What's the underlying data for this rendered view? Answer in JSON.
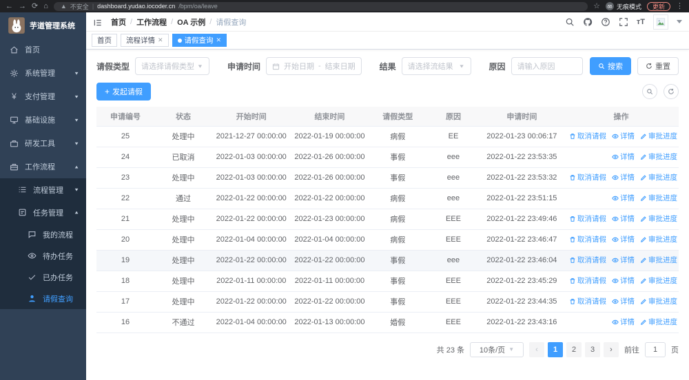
{
  "browser": {
    "security_label": "不安全",
    "url_host": "dashboard.yudao.iocoder.cn",
    "url_path": "/bpm/oa/leave",
    "incognito_label": "无痕模式",
    "update_label": "更新"
  },
  "sidebar": {
    "title": "芋道管理系统",
    "items": [
      {
        "label": "首页"
      },
      {
        "label": "系统管理"
      },
      {
        "label": "支付管理"
      },
      {
        "label": "基础设施"
      },
      {
        "label": "研发工具"
      },
      {
        "label": "工作流程"
      }
    ],
    "submenu": [
      {
        "label": "流程管理"
      },
      {
        "label": "任务管理"
      }
    ],
    "leaves": [
      {
        "label": "我的流程"
      },
      {
        "label": "待办任务"
      },
      {
        "label": "已办任务"
      },
      {
        "label": "请假查询"
      }
    ]
  },
  "navbar": {
    "breadcrumb": [
      "首页",
      "工作流程",
      "OA 示例",
      "请假查询"
    ]
  },
  "tags": [
    {
      "label": "首页"
    },
    {
      "label": "流程详情"
    },
    {
      "label": "请假查询"
    }
  ],
  "filters": {
    "leave_type_label": "请假类型",
    "leave_type_placeholder": "请选择请假类型",
    "apply_time_label": "申请时间",
    "date_start_placeholder": "开始日期",
    "date_separator": "-",
    "date_end_placeholder": "结束日期",
    "result_label": "结果",
    "result_placeholder": "请选择流结果",
    "reason_label": "原因",
    "reason_placeholder": "请输入原因",
    "search_label": "搜索",
    "reset_label": "重置"
  },
  "toolbar": {
    "create_label": "发起请假"
  },
  "table": {
    "headers": [
      "申请编号",
      "状态",
      "开始时间",
      "结束时间",
      "请假类型",
      "原因",
      "申请时间",
      "操作"
    ],
    "action_labels": {
      "cancel": "取消请假",
      "detail": "详情",
      "progress": "审批进度"
    },
    "rows": [
      {
        "id": "25",
        "status": "处理中",
        "start": "2021-12-27 00:00:00",
        "end": "2022-01-19 00:00:00",
        "type": "病假",
        "reason": "EE",
        "applied": "2022-01-23 00:06:17",
        "cancelable": true,
        "highlight": false
      },
      {
        "id": "24",
        "status": "已取消",
        "start": "2022-01-03 00:00:00",
        "end": "2022-01-26 00:00:00",
        "type": "事假",
        "reason": "eee",
        "applied": "2022-01-22 23:53:35",
        "cancelable": false,
        "highlight": false
      },
      {
        "id": "23",
        "status": "处理中",
        "start": "2022-01-03 00:00:00",
        "end": "2022-01-26 00:00:00",
        "type": "事假",
        "reason": "eee",
        "applied": "2022-01-22 23:53:32",
        "cancelable": true,
        "highlight": false
      },
      {
        "id": "22",
        "status": "通过",
        "start": "2022-01-22 00:00:00",
        "end": "2022-01-22 00:00:00",
        "type": "病假",
        "reason": "eee",
        "applied": "2022-01-22 23:51:15",
        "cancelable": false,
        "highlight": false
      },
      {
        "id": "21",
        "status": "处理中",
        "start": "2022-01-22 00:00:00",
        "end": "2022-01-23 00:00:00",
        "type": "病假",
        "reason": "EEE",
        "applied": "2022-01-22 23:49:46",
        "cancelable": true,
        "highlight": false
      },
      {
        "id": "20",
        "status": "处理中",
        "start": "2022-01-04 00:00:00",
        "end": "2022-01-04 00:00:00",
        "type": "病假",
        "reason": "EEE",
        "applied": "2022-01-22 23:46:47",
        "cancelable": true,
        "highlight": false
      },
      {
        "id": "19",
        "status": "处理中",
        "start": "2022-01-22 00:00:00",
        "end": "2022-01-22 00:00:00",
        "type": "事假",
        "reason": "eee",
        "applied": "2022-01-22 23:46:04",
        "cancelable": true,
        "highlight": true
      },
      {
        "id": "18",
        "status": "处理中",
        "start": "2022-01-11 00:00:00",
        "end": "2022-01-11 00:00:00",
        "type": "事假",
        "reason": "EEE",
        "applied": "2022-01-22 23:45:29",
        "cancelable": true,
        "highlight": false
      },
      {
        "id": "17",
        "status": "处理中",
        "start": "2022-01-22 00:00:00",
        "end": "2022-01-22 00:00:00",
        "type": "事假",
        "reason": "EEE",
        "applied": "2022-01-22 23:44:35",
        "cancelable": true,
        "highlight": false
      },
      {
        "id": "16",
        "status": "不通过",
        "start": "2022-01-04 00:00:00",
        "end": "2022-01-13 00:00:00",
        "type": "婚假",
        "reason": "EEE",
        "applied": "2022-01-22 23:43:16",
        "cancelable": false,
        "highlight": false
      }
    ]
  },
  "pagination": {
    "total": "共 23 条",
    "page_size": "10条/页",
    "pages": [
      "1",
      "2",
      "3"
    ],
    "active_page": "1",
    "goto_label": "前往",
    "goto_value": "1",
    "page_label": "页"
  }
}
